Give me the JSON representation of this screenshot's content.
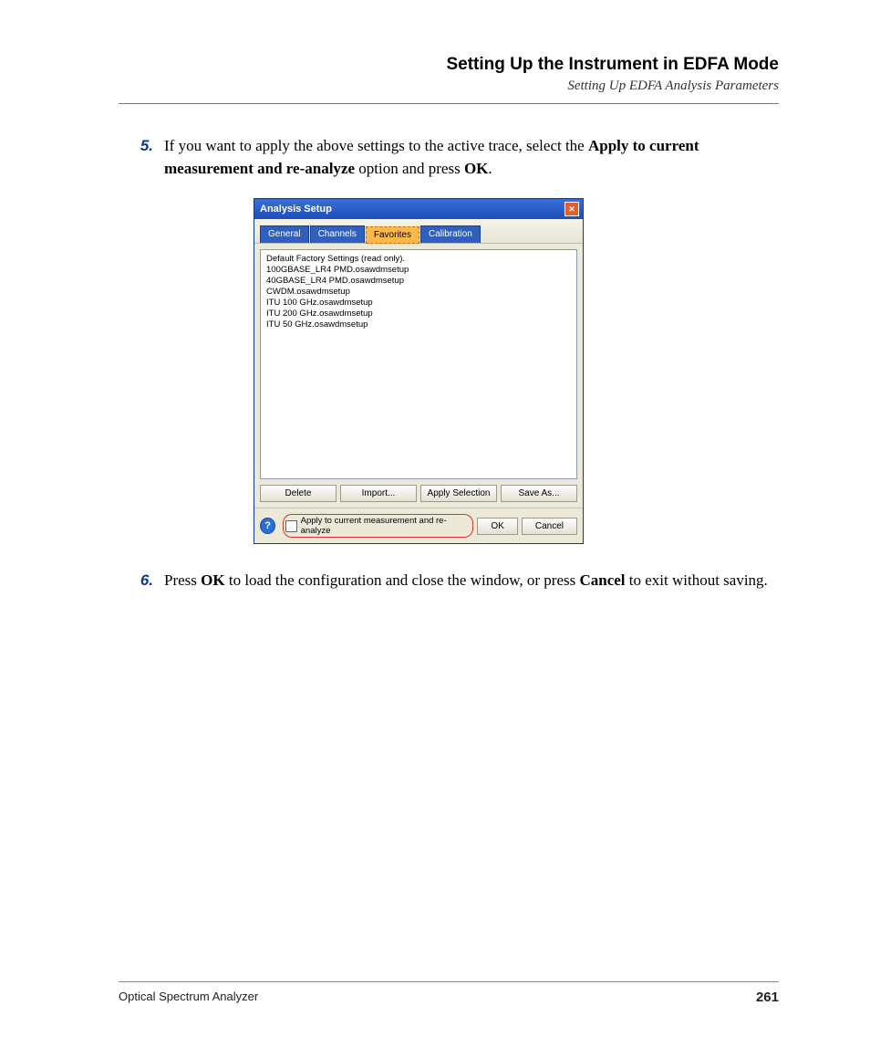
{
  "header": {
    "title": "Setting Up the Instrument in EDFA Mode",
    "subtitle": "Setting Up EDFA Analysis Parameters"
  },
  "steps": {
    "s5": {
      "num": "5.",
      "text_a": "If you want to apply the above settings to the active trace, select the ",
      "bold_a": "Apply to current measurement and re-analyze",
      "text_b": " option and press ",
      "bold_b": "OK",
      "text_c": "."
    },
    "s6": {
      "num": "6.",
      "text_a": "Press ",
      "bold_a": "OK",
      "text_b": " to load the configuration and close the window, or press ",
      "bold_b": "Cancel",
      "text_c": " to exit without saving."
    }
  },
  "dialog": {
    "title": "Analysis Setup",
    "tabs": {
      "general": "General",
      "channels": "Channels",
      "favorites": "Favorites",
      "calibration": "Calibration"
    },
    "list": {
      "i0": "Default Factory Settings (read only).",
      "i1": "100GBASE_LR4 PMD.osawdmsetup",
      "i2": "40GBASE_LR4 PMD.osawdmsetup",
      "i3": "CWDM.osawdmsetup",
      "i4": "ITU 100 GHz.osawdmsetup",
      "i5": "ITU 200 GHz.osawdmsetup",
      "i6": "ITU 50 GHz.osawdmsetup"
    },
    "buttons": {
      "delete": "Delete",
      "import": "Import...",
      "apply_sel": "Apply Selection",
      "save_as": "Save As..."
    },
    "checkbox_label": "Apply to current measurement and re-analyze",
    "ok": "OK",
    "cancel": "Cancel",
    "help": "?"
  },
  "footer": {
    "product": "Optical Spectrum Analyzer",
    "page": "261"
  }
}
